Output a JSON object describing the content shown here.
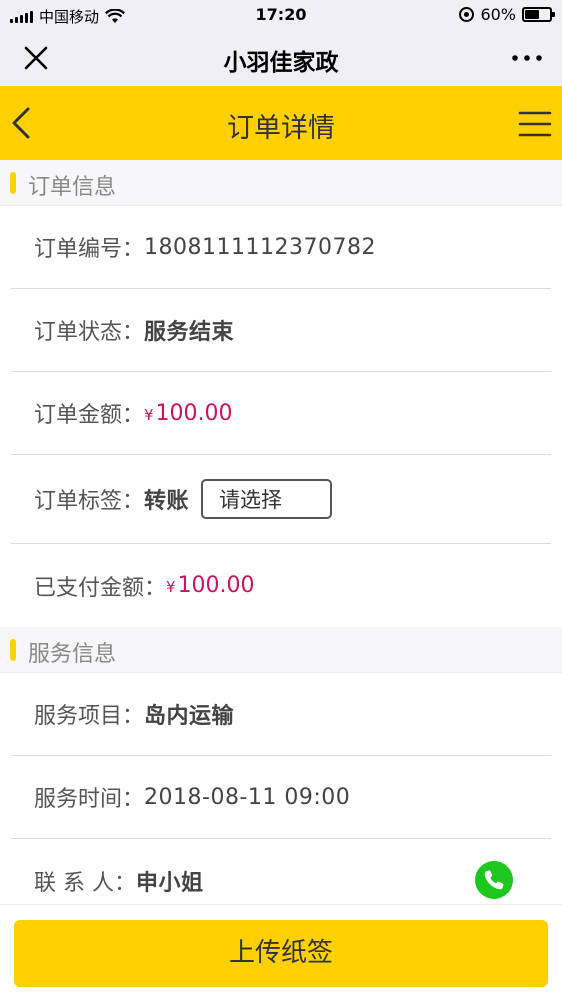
{
  "status_bar": {
    "carrier": "中国移动",
    "time": "17:20",
    "battery_pct": "60%",
    "battery_level": 0.6,
    "icons": [
      "signal-icon",
      "wifi-icon",
      "orientation-lock-icon",
      "battery-icon"
    ]
  },
  "wechat_bar": {
    "title": "小羽佳家政",
    "icons": [
      "close-icon",
      "more-icon"
    ]
  },
  "header": {
    "title": "订单详情",
    "icons": [
      "back-chevron-icon",
      "menu-icon"
    ],
    "color": "#ffd000"
  },
  "order_section": {
    "title": "订单信息",
    "number_label": "订单编号：",
    "number": "1808111112370782",
    "status_label": "订单状态：",
    "status": "服务结束",
    "amount_label": "订单金额：",
    "amount_currency": "¥",
    "amount": "100.00",
    "tag_label": "订单标签：",
    "tag": "转账",
    "tag_select_placeholder": "请选择",
    "paid_label": "已支付金额：",
    "paid_currency": "¥",
    "paid": "100.00"
  },
  "service_section": {
    "title": "服务信息",
    "item_label": "服务项目：",
    "item": "岛内运输",
    "time_label": "服务时间：",
    "time": "2018-08-11 09:00",
    "contact_label": "联 系 人：",
    "contact": "申小姐",
    "call_icon": "phone-icon"
  },
  "actions": {
    "upload_label": "上传纸签"
  },
  "colors": {
    "accent": "#ffd000",
    "price": "#c8155f",
    "call": "#1ec71e"
  }
}
